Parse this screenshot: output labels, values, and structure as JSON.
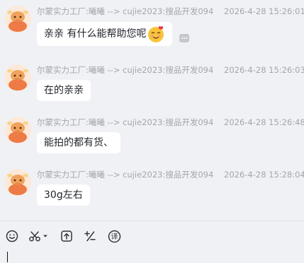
{
  "colors": {
    "background": "#f0f1f5",
    "bubble": "#ffffff",
    "meta_text": "#a2a6ad",
    "message_text": "#1f2329"
  },
  "messages": [
    {
      "sender": "尔蒙实力工厂:曦曦 --> cujie2023:搜品开发094",
      "time": "2026-4-28 15:26:01",
      "text": "亲亲 有什么能帮助您呢",
      "emoji": "smiling-face-with-hearts-icon"
    },
    {
      "sender": "尔蒙实力工厂:曦曦 --> cujie2023:搜品开发094",
      "time": "2026-4-28 15:26:03",
      "text": "在的亲亲"
    },
    {
      "sender": "尔蒙实力工厂:曦曦 --> cujie2023:搜品开发094",
      "time": "2026-4-28 15:26:48",
      "text": "能拍的都有货、"
    },
    {
      "sender": "尔蒙实力工厂:曦曦 --> cujie2023:搜品开发094",
      "time": "2026-4-28 15:28:04",
      "text": "30g左右"
    }
  ],
  "toolbar": {
    "icons": [
      "emoji-icon",
      "scissors-icon",
      "chevron-down-icon",
      "upload-file-icon",
      "quick-phrase-icon",
      "translate-icon"
    ]
  },
  "input": {
    "value": ""
  }
}
